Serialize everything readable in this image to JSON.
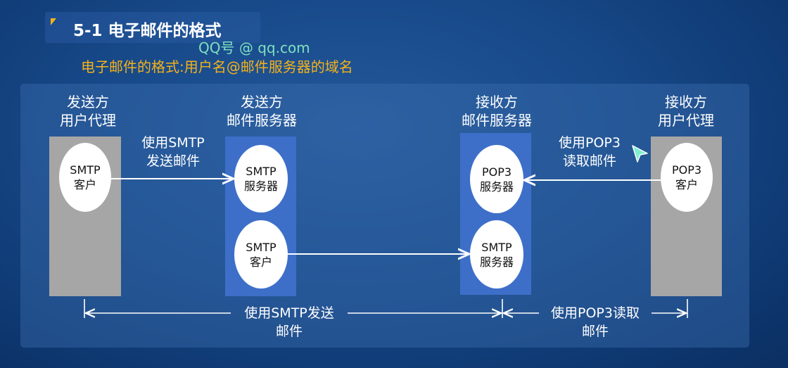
{
  "header": {
    "title": "5-1 电子邮件的格式",
    "watermark": "QQ号 @ qq.com",
    "subtitle": "电子邮件的格式:用户名@邮件服务器的域名"
  },
  "columns": [
    {
      "line1": "发送方",
      "line2": "用户代理"
    },
    {
      "line1": "发送方",
      "line2": "邮件服务器"
    },
    {
      "line1": "接收方",
      "line2": "邮件服务器"
    },
    {
      "line1": "接收方",
      "line2": "用户代理"
    }
  ],
  "nodes": {
    "sender_agent_client": {
      "line1": "SMTP",
      "line2": "客户"
    },
    "sender_server_smtp_server": {
      "line1": "SMTP",
      "line2": "服务器"
    },
    "sender_server_smtp_client": {
      "line1": "SMTP",
      "line2": "客户"
    },
    "receiver_server_pop3_server": {
      "line1": "POP3",
      "line2": "服务器"
    },
    "receiver_server_smtp_server": {
      "line1": "SMTP",
      "line2": "服务器"
    },
    "receiver_agent_pop3_client": {
      "line1": "POP3",
      "line2": "客户"
    }
  },
  "arrow_labels": {
    "send_smtp": {
      "line1": "使用SMTP",
      "line2": "发送邮件"
    },
    "read_pop3": {
      "line1": "使用POP3",
      "line2": "读取邮件"
    }
  },
  "bottom_labels": {
    "smtp_span": {
      "line1": "使用SMTP发送",
      "line2": "邮件"
    },
    "pop3_span": {
      "line1": "使用POP3读取",
      "line2": "邮件"
    }
  },
  "colors": {
    "background": "#184a8a",
    "accent": "#f5b21a",
    "agent_box": "#a6a6a6",
    "server_box": "#3d6fc9",
    "watermark": "#7fe0c0",
    "cursor": "#7ff0d0"
  }
}
